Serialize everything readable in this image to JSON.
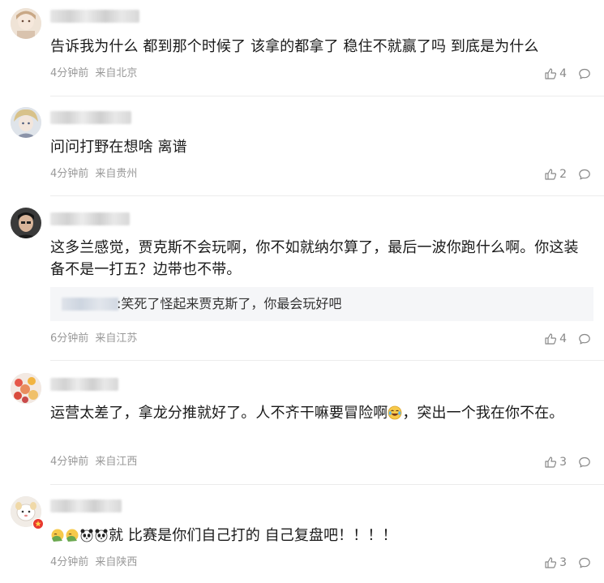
{
  "comments": [
    {
      "text": "告诉我为什么 都到那个时候了 该拿的都拿了 稳住不就赢了吗 到底是为什么",
      "time": "4分钟前",
      "location": "来自北京",
      "likes": "4"
    },
    {
      "text": "问问打野在想啥 离谱",
      "time": "4分钟前",
      "location": "来自贵州",
      "likes": "2"
    },
    {
      "text": "这多兰感觉，贾克斯不会玩啊，你不如就纳尔算了，最后一波你跑什么啊。你这装备不是一打五？边带也不带。",
      "reply_text": ":笑死了怪起来贾克斯了，你最会玩好吧",
      "time": "6分钟前",
      "location": "来自江苏",
      "likes": "4"
    },
    {
      "text_a": "运营太差了，拿龙分推就好了。人不齐干嘛要冒险啊",
      "text_b": "，突出一个我在你不在。",
      "time": "4分钟前",
      "location": "来自江西",
      "likes": "3"
    },
    {
      "text": "就 比赛是你们自己打的 自己复盘吧！！！！",
      "time": "4分钟前",
      "location": "来自陕西",
      "likes": "3"
    }
  ],
  "icons": {
    "like": "thumbs-up-icon",
    "reply": "comment-bubble-icon"
  },
  "colors": {
    "meta": "#999999",
    "divider": "#ececec",
    "reply_bg": "#f5f6f8"
  }
}
